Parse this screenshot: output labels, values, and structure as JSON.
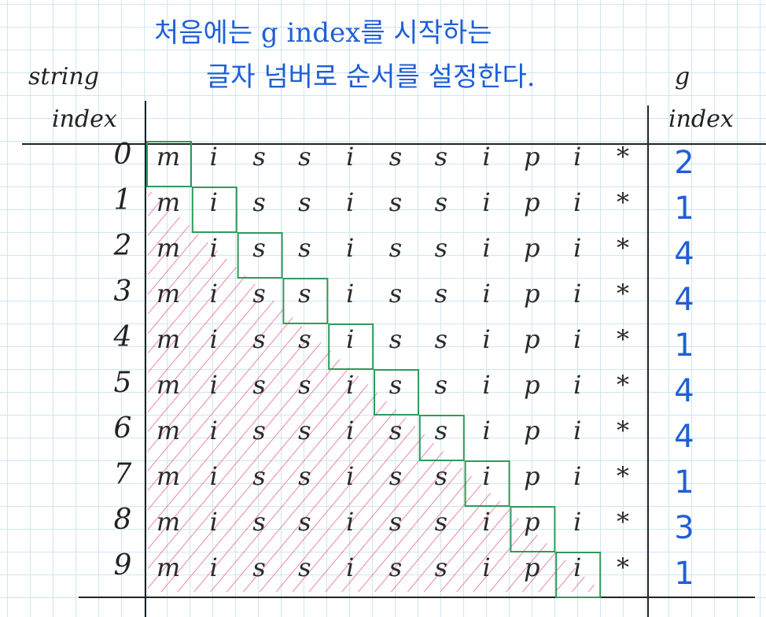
{
  "title": {
    "line1": "처음에는  g index를 시작하는",
    "line2": "글자 넘버로 순서를 설정한다."
  },
  "headers": {
    "string_index": [
      "string",
      "index"
    ],
    "g_index": [
      "g",
      "index"
    ]
  },
  "row_indices": [
    "0",
    "1",
    "2",
    "3",
    "4",
    "5",
    "6",
    "7",
    "8",
    "9"
  ],
  "columns": [
    "m",
    "i",
    "s",
    "s",
    "i",
    "s",
    "s",
    "i",
    "p",
    "i",
    "*"
  ],
  "g_index_values": [
    "2",
    "1",
    "4",
    "4",
    "1",
    "4",
    "4",
    "1",
    "3",
    "1"
  ],
  "highlight_color": "#2e9a5a",
  "hatch_color": "#e0336e",
  "accent_color": "#1f5fd6"
}
